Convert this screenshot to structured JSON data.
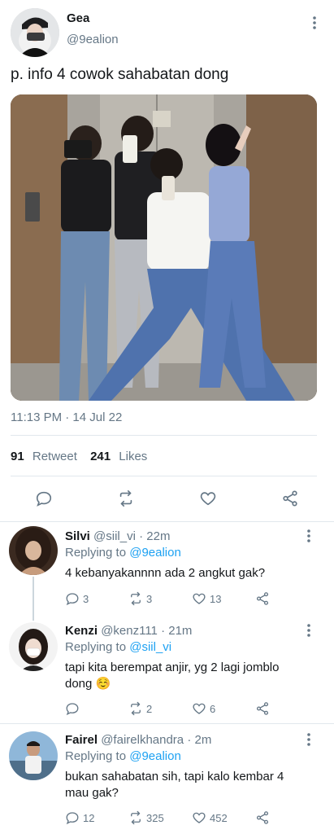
{
  "tweet": {
    "name": "Gea",
    "handle": "@9ealion",
    "text": "p. info 4 cowok sahabatan dong",
    "time": "11:13 PM · 14 Jul 22",
    "retweets": "91",
    "retweets_label": "Retweet",
    "likes": "241",
    "likes_label": "Likes"
  },
  "replies": [
    {
      "name": "Silvi",
      "handle": "@siil_vi · 22m",
      "replying_prefix": "Replying to",
      "replying_to": "@9ealion",
      "text": "4 kebanyakannnn ada 2 angkut gak?",
      "replies": "3",
      "retweets": "3",
      "likes": "13"
    },
    {
      "name": "Kenzi",
      "handle": "@kenz111 · 21m",
      "replying_prefix": "Replying to",
      "replying_to": "@siil_vi",
      "text": "tapi kita berempat anjir, yg 2 lagi jomblo dong ☺️",
      "replies": "",
      "retweets": "2",
      "likes": "6"
    },
    {
      "name": "Fairel",
      "handle": "@fairelkhandra · 2m",
      "replying_prefix": "Replying to",
      "replying_to": "@9ealion",
      "text": "bukan sahabatan sih, tapi kalo kembar 4 mau gak?",
      "replies": "12",
      "retweets": "325",
      "likes": "452"
    }
  ],
  "colors": {
    "accent": "#1da1f2",
    "secondary_text": "#657786",
    "icon": "#657786",
    "divider": "#e1e8ed"
  },
  "icons": {
    "reply": "reply-icon",
    "retweet": "retweet-icon",
    "like": "heart-icon",
    "share": "share-icon",
    "more": "more-vertical-icon"
  }
}
